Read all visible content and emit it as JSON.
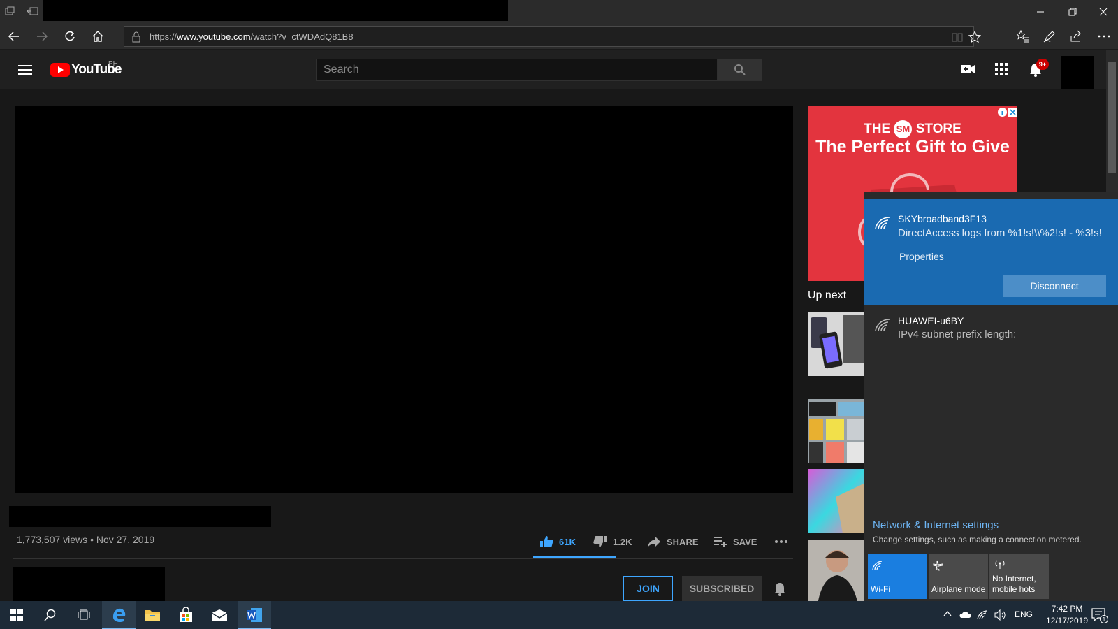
{
  "browser": {
    "url_prefix": "https://",
    "url_domain": "www.youtube.com",
    "url_path": "/watch?v=ctWDAdQ81B8"
  },
  "youtube": {
    "logo_text": "YouTube",
    "region": "PH",
    "search_placeholder": "Search",
    "notification_badge": "9+"
  },
  "video": {
    "views_date": "1,773,507 views • Nov 27, 2019",
    "likes": "61K",
    "dislikes": "1.2K",
    "share_label": "SHARE",
    "save_label": "SAVE",
    "join_label": "JOIN",
    "subscribed_label": "SUBSCRIBED"
  },
  "sidebar": {
    "ad_line1_pre": "THE",
    "ad_logo": "SM",
    "ad_line1_post": "STORE",
    "ad_line2": "The Perfect Gift to Give",
    "up_next": "Up next"
  },
  "wifi_flyout": {
    "networks": [
      {
        "name": "SKYbroadband3F13",
        "status": "DirectAccess logs from %1!s!\\\\%2!s! - %3!s!"
      },
      {
        "name": "HUAWEI-u6BY",
        "status": "IPv4 subnet prefix length:"
      }
    ],
    "properties_link": "Properties",
    "disconnect_label": "Disconnect",
    "settings_title": "Network & Internet settings",
    "settings_desc": "Change settings, such as making a connection metered.",
    "quick_actions": [
      {
        "label": "Wi-Fi",
        "active": true
      },
      {
        "label": "Airplane mode",
        "active": false
      },
      {
        "label": "No Internet, mobile hots",
        "active": false
      }
    ]
  },
  "taskbar": {
    "language": "ENG",
    "time": "7:42 PM",
    "date": "12/17/2019",
    "notification_count": "1"
  },
  "colors": {
    "accent_blue": "#1a6ab1",
    "yt_red": "#ff0000",
    "yt_blue": "#3ea6ff",
    "ad_red": "#e3343e"
  }
}
